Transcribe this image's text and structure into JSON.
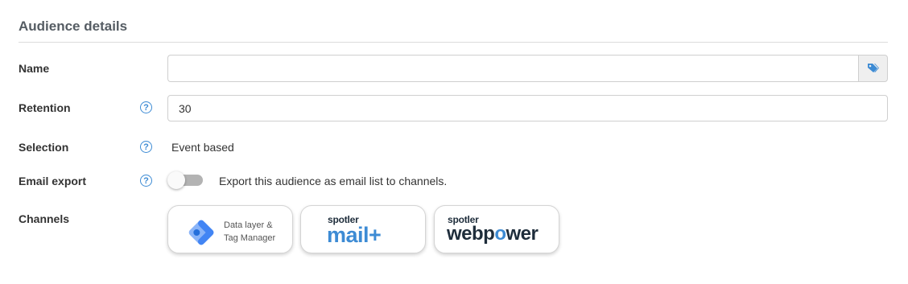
{
  "section": {
    "title": "Audience details"
  },
  "fields": {
    "name": {
      "label": "Name",
      "value": "",
      "addon_icon": "tags-icon"
    },
    "retention": {
      "label": "Retention",
      "value": "30",
      "help_icon": "question-circle-icon"
    },
    "selection": {
      "label": "Selection",
      "value": "Event based",
      "help_icon": "question-circle-icon"
    },
    "email_export": {
      "label": "Email export",
      "toggle_on": false,
      "description": "Export this audience as email list to channels.",
      "help_icon": "question-circle-icon"
    },
    "channels": {
      "label": "Channels",
      "items": [
        {
          "id": "gtm",
          "line1": "Data layer &",
          "line2": "Tag Manager",
          "icon": "google-tag-manager-icon"
        },
        {
          "id": "mailplus",
          "brand_small": "spotler",
          "brand_big": "mail+",
          "color": "#3d8bd4"
        },
        {
          "id": "webpower",
          "brand_small": "spotler",
          "brand_big_a": "webp",
          "brand_big_o": "o",
          "brand_big_b": "wer",
          "color": "#1e2d3b",
          "accent": "#3d8bd4"
        }
      ]
    }
  },
  "colors": {
    "accent": "#3d8bd4",
    "toggle_off": "#b3b3b3"
  }
}
